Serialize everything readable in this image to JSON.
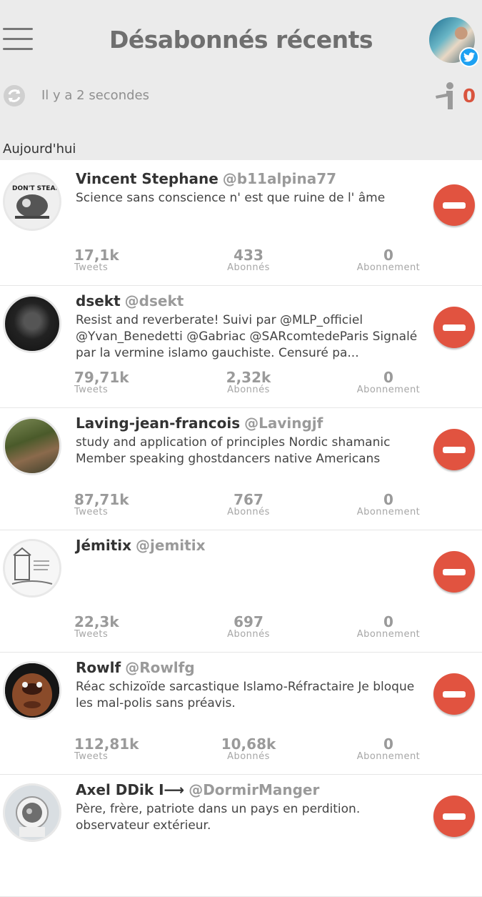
{
  "header": {
    "title": "Désabonnés récents",
    "last_refresh": "Il y a 2 secondes",
    "unfollow_count": "0",
    "accent_color": "#d9543e",
    "twitter_color": "#1da1f2"
  },
  "section_label": "Aujourd'hui",
  "stat_labels": {
    "tweets": "Tweets",
    "followers": "Abonnés",
    "following": "Abonnement"
  },
  "users": [
    {
      "name": "Vincent Stephane",
      "handle": "@b11alpina77",
      "bio": "Science sans conscience n' est que ruine de l' âme",
      "tweets": "17,1k",
      "followers": "433",
      "following": "0"
    },
    {
      "name": "dsekt",
      "handle": "@dsekt",
      "bio": "Resist and reverberate! Suivi par @MLP_officiel @Yvan_Benedetti @Gabriac @SARcomtedeParis Signalé par la vermine islamo gauchiste. Censuré pa...",
      "tweets": "79,71k",
      "followers": "2,32k",
      "following": "0"
    },
    {
      "name": "Laving-jean-francois",
      "handle": "@Lavingjf",
      "bio": "study and application of principles Nordic shamanic Member speaking ghostdancers native Americans",
      "tweets": "87,71k",
      "followers": "767",
      "following": "0"
    },
    {
      "name": "Jémitix",
      "handle": "@jemitix",
      "bio": "",
      "tweets": "22,3k",
      "followers": "697",
      "following": "0"
    },
    {
      "name": "Rowlf",
      "handle": "@Rowlfg",
      "bio": "Réac schizoïde sarcastique Islamo-Réfractaire Je bloque les mal-polis sans préavis.",
      "tweets": "112,81k",
      "followers": "10,68k",
      "following": "0"
    },
    {
      "name": "Axel DDik I⟶",
      "handle": "@DormirManger",
      "bio": "Père, frère, patriote dans un pays en perdition. observateur extérieur.",
      "tweets": "",
      "followers": "",
      "following": ""
    }
  ]
}
